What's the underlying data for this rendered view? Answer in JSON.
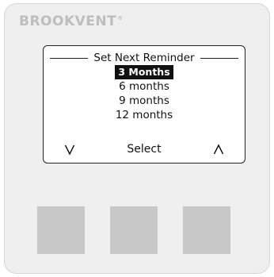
{
  "brand": {
    "name": "BROOKVENT",
    "mark": "®"
  },
  "display": {
    "title": "Set Next Reminder",
    "options": [
      {
        "label": "3 Months",
        "selected": true
      },
      {
        "label": "6 months",
        "selected": false
      },
      {
        "label": "9 months",
        "selected": false
      },
      {
        "label": "12 months",
        "selected": false
      }
    ],
    "softkeys": {
      "down": "chevron-down-icon",
      "select_label": "Select",
      "up": "chevron-up-icon"
    }
  },
  "buttons": [
    {
      "name": "left-button"
    },
    {
      "name": "middle-button"
    },
    {
      "name": "right-button"
    }
  ],
  "colors": {
    "device_bg": "#efefef",
    "screen_bg": "#ffffff",
    "highlight": "#111111",
    "button": "#c8c8c8",
    "brand": "#bdbdbd"
  }
}
